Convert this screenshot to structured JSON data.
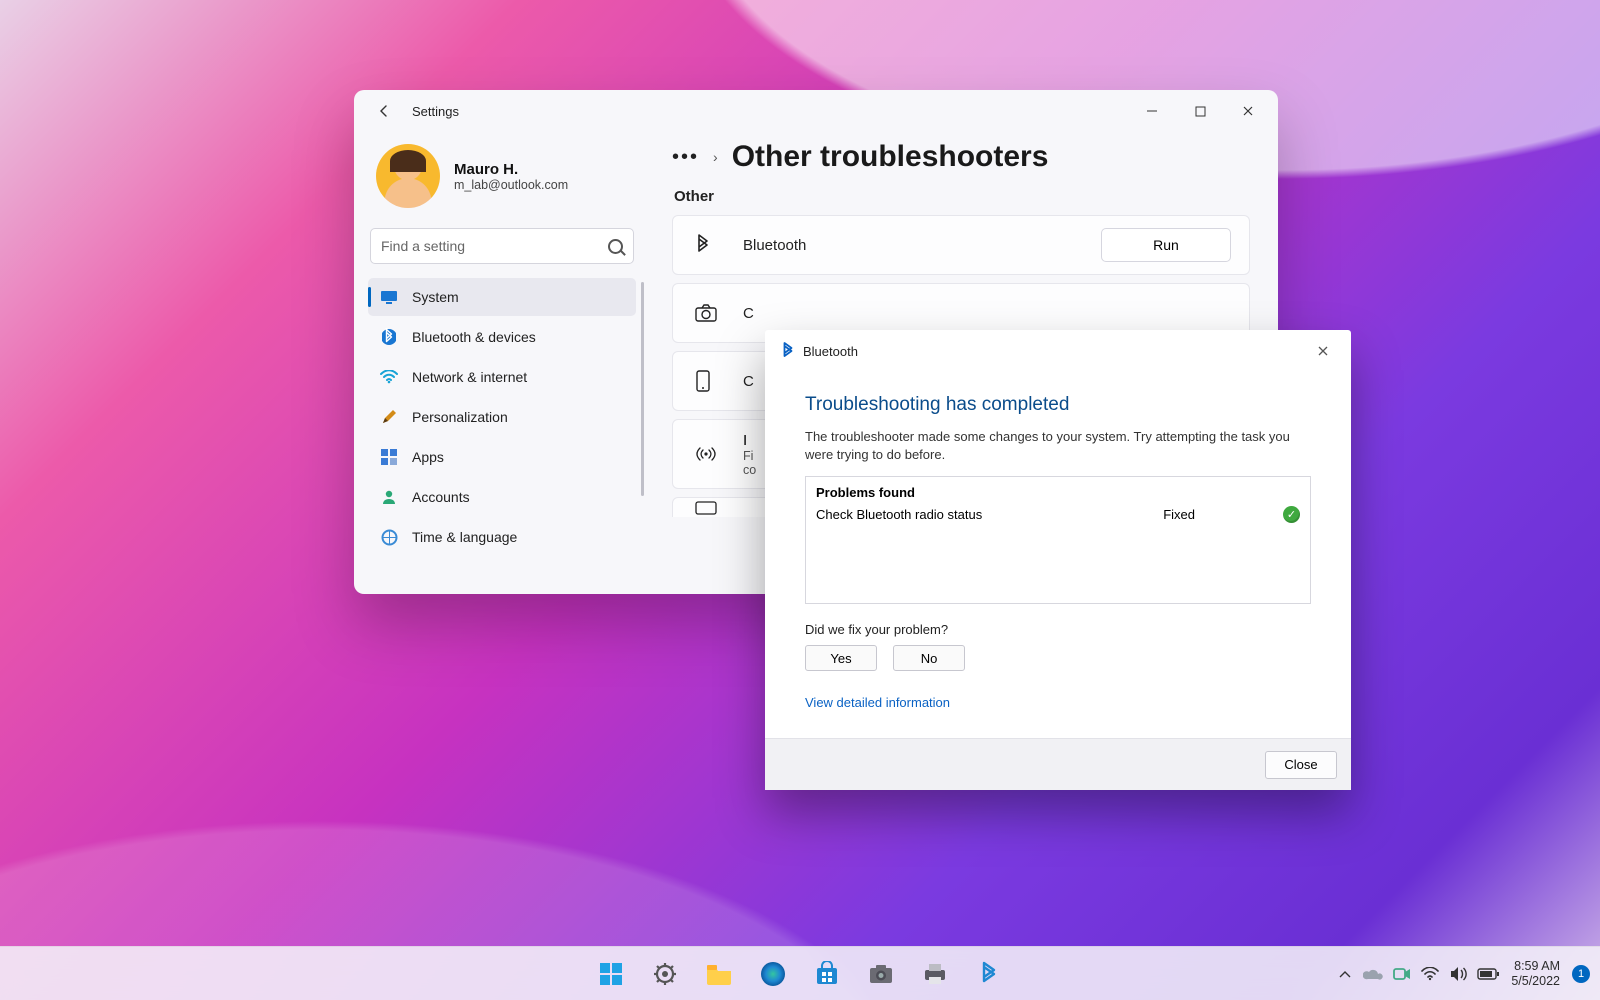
{
  "window": {
    "title": "Settings",
    "user": {
      "name": "Mauro H.",
      "email": "m_lab@outlook.com"
    },
    "search_placeholder": "Find a setting",
    "nav": [
      {
        "label": "System"
      },
      {
        "label": "Bluetooth & devices"
      },
      {
        "label": "Network & internet"
      },
      {
        "label": "Personalization"
      },
      {
        "label": "Apps"
      },
      {
        "label": "Accounts"
      },
      {
        "label": "Time & language"
      }
    ],
    "breadcrumb_title": "Other troubleshooters",
    "section": "Other",
    "troubleshooters": {
      "bluetooth": {
        "label": "Bluetooth",
        "button": "Run"
      },
      "camera_partial": "C",
      "connected_partial": "C",
      "incoming": {
        "label_partial": "I",
        "sub1_partial": "Fi",
        "sub2_partial": "co"
      }
    }
  },
  "dialog": {
    "app": "Bluetooth",
    "heading": "Troubleshooting has completed",
    "description": "The troubleshooter made some changes to your system. Try attempting the task you were trying to do before.",
    "problems_header": "Problems found",
    "problem": {
      "name": "Check Bluetooth radio status",
      "status": "Fixed"
    },
    "question": "Did we fix your problem?",
    "yes": "Yes",
    "no": "No",
    "link": "View detailed information",
    "close": "Close"
  },
  "taskbar": {
    "time": "8:59 AM",
    "date": "5/5/2022",
    "notif_count": "1"
  }
}
